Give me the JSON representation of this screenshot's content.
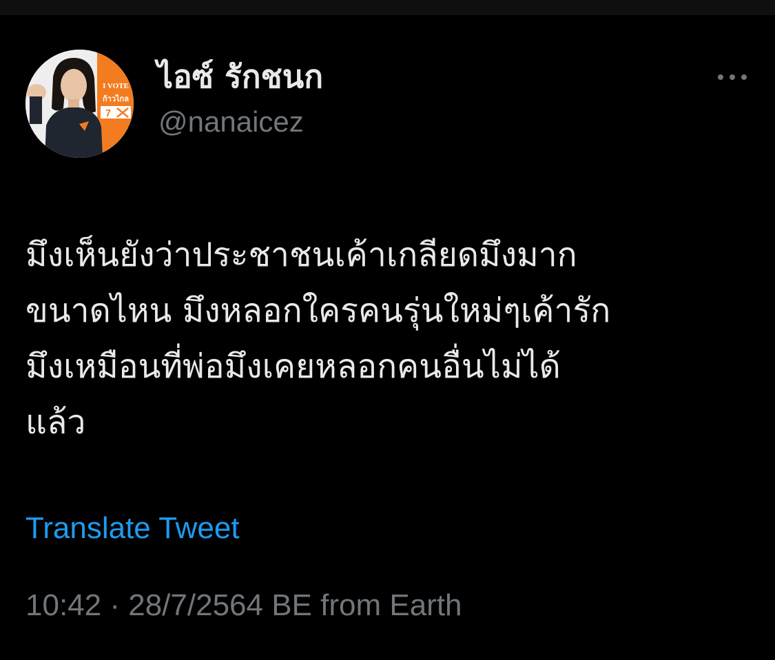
{
  "tweet": {
    "author": {
      "display_name": "ไอซ์ รักชนก",
      "handle": "@nanaicez",
      "avatar_badge": {
        "line1": "I VOTE",
        "line2": "ก้าวไกล",
        "number": "7"
      }
    },
    "text_lines": [
      "มึงเห็นยังว่าประชาชนเค้าเกลียดมึงมาก",
      "ขนาดไหน มึงหลอกใครคนรุ่นใหม่ๆเค้ารัก",
      "มึงเหมือนที่พ่อมึงเคยหลอกคนอื่นไม่ได้",
      "แล้ว"
    ],
    "translate_label": "Translate Tweet",
    "time": "10:42",
    "separator": "·",
    "date": "28/7/2564 BE",
    "source": "from Earth"
  },
  "colors": {
    "background": "#000000",
    "text_primary": "#e7e9ea",
    "text_secondary": "#71767b",
    "link": "#1d9bf0",
    "badge_orange": "#f47c20"
  },
  "icons": {
    "more": "more-horizontal-icon"
  }
}
